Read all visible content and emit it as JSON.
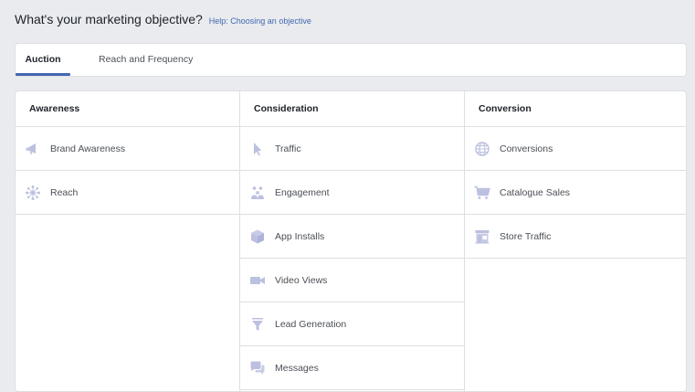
{
  "header": {
    "title": "What's your marketing objective?",
    "help_link": "Help: Choosing an objective"
  },
  "tabs": [
    {
      "label": "Auction",
      "selected": true
    },
    {
      "label": "Reach and Frequency",
      "selected": false
    }
  ],
  "columns": [
    {
      "header": "Awareness",
      "items": [
        {
          "label": "Brand Awareness",
          "icon": "megaphone-icon"
        },
        {
          "label": "Reach",
          "icon": "reach-icon"
        }
      ]
    },
    {
      "header": "Consideration",
      "items": [
        {
          "label": "Traffic",
          "icon": "cursor-icon"
        },
        {
          "label": "Engagement",
          "icon": "people-icon"
        },
        {
          "label": "App Installs",
          "icon": "box-icon"
        },
        {
          "label": "Video Views",
          "icon": "video-camera-icon"
        },
        {
          "label": "Lead Generation",
          "icon": "funnel-icon"
        },
        {
          "label": "Messages",
          "icon": "chat-bubbles-icon"
        }
      ]
    },
    {
      "header": "Conversion",
      "items": [
        {
          "label": "Conversions",
          "icon": "globe-icon"
        },
        {
          "label": "Catalogue Sales",
          "icon": "shopping-cart-icon"
        },
        {
          "label": "Store Traffic",
          "icon": "store-icon"
        }
      ]
    }
  ],
  "colors": {
    "accent": "#4267b2",
    "icon": "#bcc0e0",
    "background": "#e9ebee"
  }
}
